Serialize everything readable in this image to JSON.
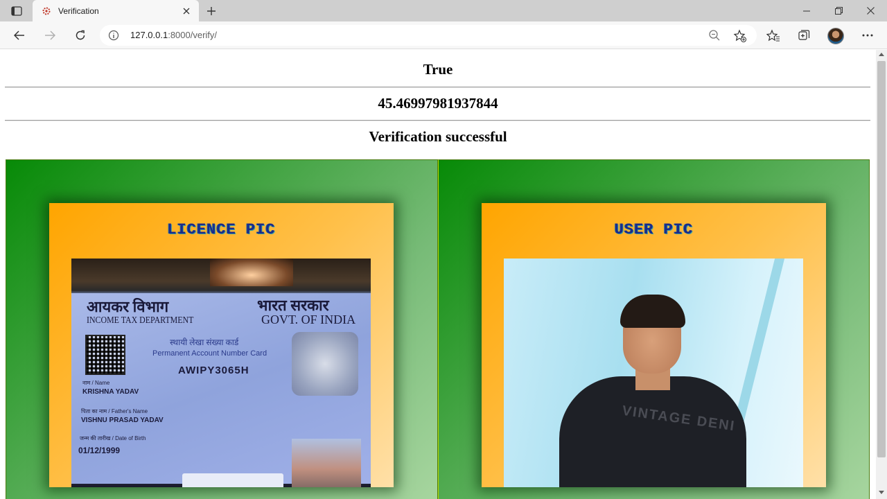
{
  "browser": {
    "tab_title": "Verification",
    "url_host": "127.0.0.1",
    "url_path": ":8000/verify/"
  },
  "page": {
    "result": "True",
    "score": "45.46997981937844",
    "message": "Verification successful"
  },
  "cards": {
    "licence": {
      "title": "LICENCE PIC",
      "id_card": {
        "hindi_dept": "आयकर विभाग",
        "hindi_govt": "भारत सरकार",
        "dept": "INCOME TAX DEPARTMENT",
        "govt": "GOVT. OF INDIA",
        "card_hindi": "स्थायी लेखा संख्या कार्ड",
        "card_type": "Permanent Account Number Card",
        "pan": "AWIPY3065H",
        "name_label": "नाम / Name",
        "name": "KRISHNA YADAV",
        "father_label": "पिता का नाम / Father's Name",
        "father_name": "VISHNU PRASAD YADAV",
        "dob_label": "जन्म की तारीख / Date of Birth",
        "dob": "01/12/1999"
      }
    },
    "user": {
      "title": "USER PIC",
      "shirt_text": "VINTAGE DENI"
    }
  },
  "colors": {
    "panel_green": "#078a07",
    "card_orange": "#ffa500",
    "card_title": "#1a2a8a"
  }
}
